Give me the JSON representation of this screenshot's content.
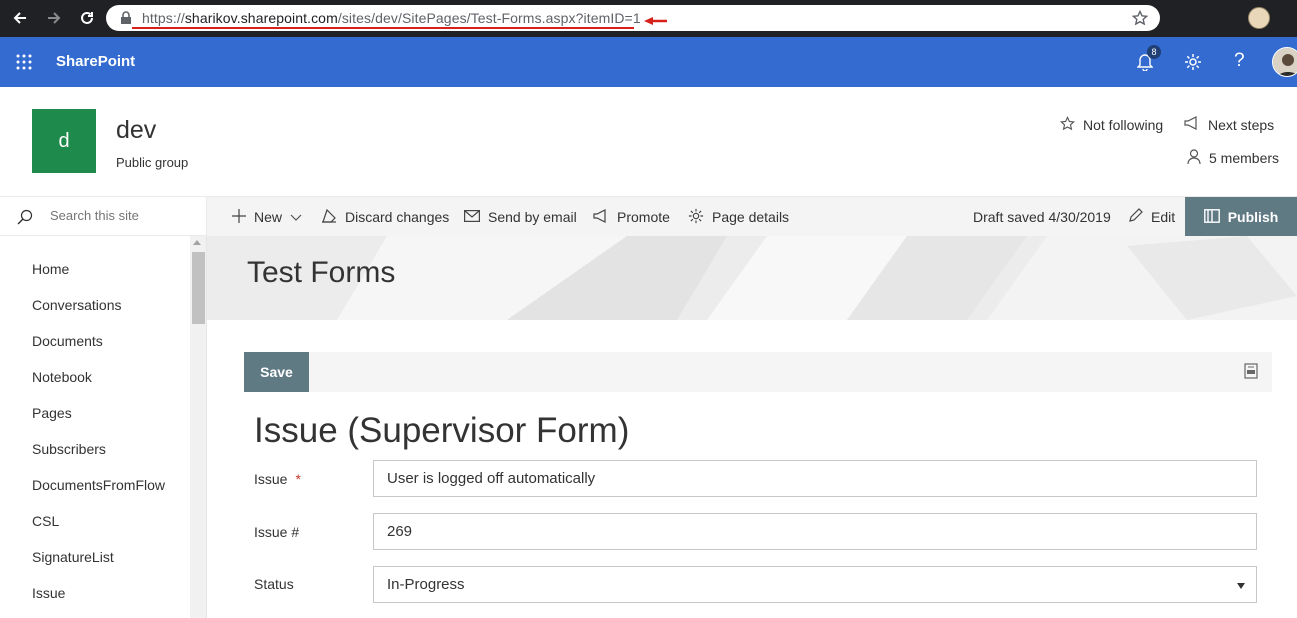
{
  "browser": {
    "url_scheme": "https://",
    "url_host": "sharikov.sharepoint.com",
    "url_path": "/sites/dev/SitePages/Test-Forms.aspx?itemID=1",
    "annotation_color": "#d6201c"
  },
  "suite": {
    "brand": "SharePoint",
    "notifications_count": "8",
    "color": "#336bd0"
  },
  "site": {
    "logo_letter": "d",
    "title": "dev",
    "subtitle": "Public group",
    "follow_label": "Not following",
    "next_steps_label": "Next steps",
    "members_label": "5 members",
    "logo_color": "#1e8a4c"
  },
  "search": {
    "placeholder": "Search this site"
  },
  "commandbar": {
    "new_label": "New",
    "discard_label": "Discard changes",
    "email_label": "Send by email",
    "promote_label": "Promote",
    "details_label": "Page details",
    "draft_status": "Draft saved 4/30/2019",
    "edit_label": "Edit",
    "publish_label": "Publish"
  },
  "nav": {
    "items": [
      {
        "label": "Home"
      },
      {
        "label": "Conversations"
      },
      {
        "label": "Documents"
      },
      {
        "label": "Notebook"
      },
      {
        "label": "Pages"
      },
      {
        "label": "Subscribers"
      },
      {
        "label": "DocumentsFromFlow"
      },
      {
        "label": "CSL"
      },
      {
        "label": "SignatureList"
      },
      {
        "label": "Issue"
      }
    ]
  },
  "page": {
    "title": "Test Forms"
  },
  "form": {
    "save_label": "Save",
    "title": "Issue (Supervisor Form)",
    "required_mark": "*",
    "fields": [
      {
        "label": "Issue",
        "value": "User is logged off automatically"
      },
      {
        "label": "Issue #",
        "value": "269"
      },
      {
        "label": "Status",
        "value": "In-Progress"
      }
    ]
  }
}
